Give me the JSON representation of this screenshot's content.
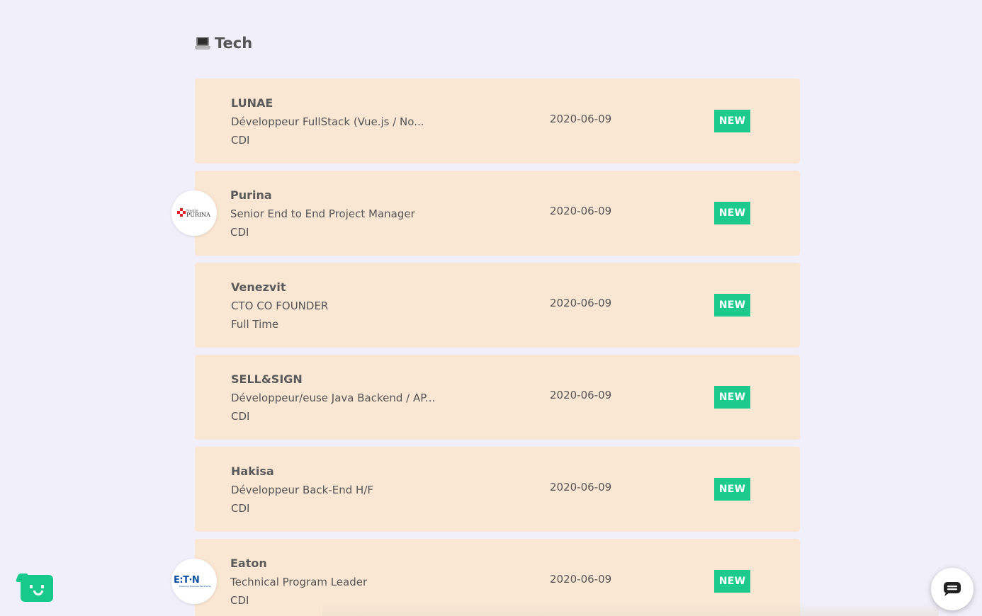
{
  "section": {
    "title": "Tech",
    "icon": "laptop-icon"
  },
  "jobs": [
    {
      "company": "LUNAE",
      "title": "Développeur FullStack (Vue.js / No...",
      "contract": "CDI",
      "date": "2020-06-09",
      "badge": "NEW",
      "logo": null
    },
    {
      "company": "Purina",
      "title": "Senior End to End Project Manager",
      "contract": "CDI",
      "date": "2020-06-09",
      "badge": "NEW",
      "logo": "PURINA"
    },
    {
      "company": "Venezvit",
      "title": "CTO CO FOUNDER",
      "contract": "Full Time",
      "date": "2020-06-09",
      "badge": "NEW",
      "logo": null
    },
    {
      "company": "SELL&SIGN",
      "title": "Développeur/euse Java Backend / AP...",
      "contract": "CDI",
      "date": "2020-06-09",
      "badge": "NEW",
      "logo": null
    },
    {
      "company": "Hakisa",
      "title": "Développeur Back-End H/F",
      "contract": "CDI",
      "date": "2020-06-09",
      "badge": "NEW",
      "logo": null
    },
    {
      "company": "Eaton",
      "title": "Technical Program Leader",
      "contract": "CDI",
      "date": "2020-06-09",
      "badge": "NEW",
      "logo": "EATON"
    }
  ],
  "colors": {
    "background": "#f1f0fa",
    "card": "#fae7d3",
    "badge": "#1ccb8b",
    "bot": "#17c98b"
  },
  "widgets": {
    "bot_icon": "bot-face-icon",
    "chat_icon": "chat-icon"
  }
}
